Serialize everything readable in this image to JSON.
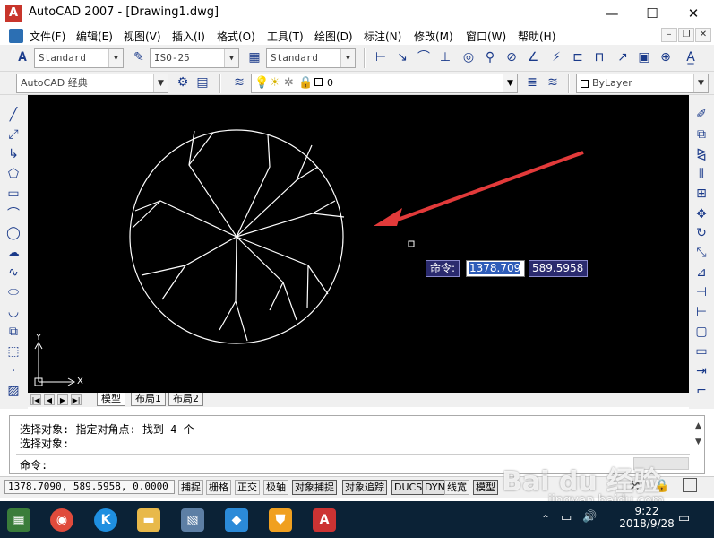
{
  "window": {
    "title": "AutoCAD 2007 - [Drawing1.dwg]",
    "icon": "autocad-app-icon",
    "minimize_glyph": "—",
    "maximize_glyph": "☐",
    "close_glyph": "✕"
  },
  "menu": {
    "items": [
      "文件(F)",
      "编辑(E)",
      "视图(V)",
      "插入(I)",
      "格式(O)",
      "工具(T)",
      "绘图(D)",
      "标注(N)",
      "修改(M)",
      "窗口(W)",
      "帮助(H)"
    ],
    "mdi_minimize": "–",
    "mdi_restore": "❐",
    "mdi_close": "✕"
  },
  "toolbar1": {
    "text_style": "Standard",
    "dim_style": "ISO-25",
    "table_style": "Standard"
  },
  "toolbar2": {
    "workspace": "AutoCAD 经典",
    "layer": "0",
    "color": "ByLayer"
  },
  "dynamic_input": {
    "label": "命令:",
    "x_value": "1378.709",
    "y_value": "589.5958"
  },
  "ucs": {
    "y_label": "Y",
    "x_label": "X"
  },
  "layout_tabs": [
    "模型",
    "布局1",
    "布局2"
  ],
  "command": {
    "history": [
      "选择对象: 指定对角点: 找到 4 个",
      "选择对象:"
    ],
    "prompt": "命令:"
  },
  "status": {
    "coordinates": "1378.7090, 589.5958, 0.0000",
    "toggles": [
      "捕捉",
      "栅格",
      "正交",
      "极轴",
      "对象捕捉",
      "对象追踪",
      "DUCS",
      "DYN",
      "线宽",
      "模型"
    ]
  },
  "taskbar": {
    "time": "9:22",
    "date": "2018/9/28"
  },
  "watermark": {
    "brand": "Bai du 经验",
    "url": "jingyan.baidu.com"
  },
  "colors": {
    "canvas_background": "#000000",
    "drawing_lines": "#ffffff",
    "annotation_arrow": "#e23a3a",
    "taskbar": "#0b2236"
  }
}
